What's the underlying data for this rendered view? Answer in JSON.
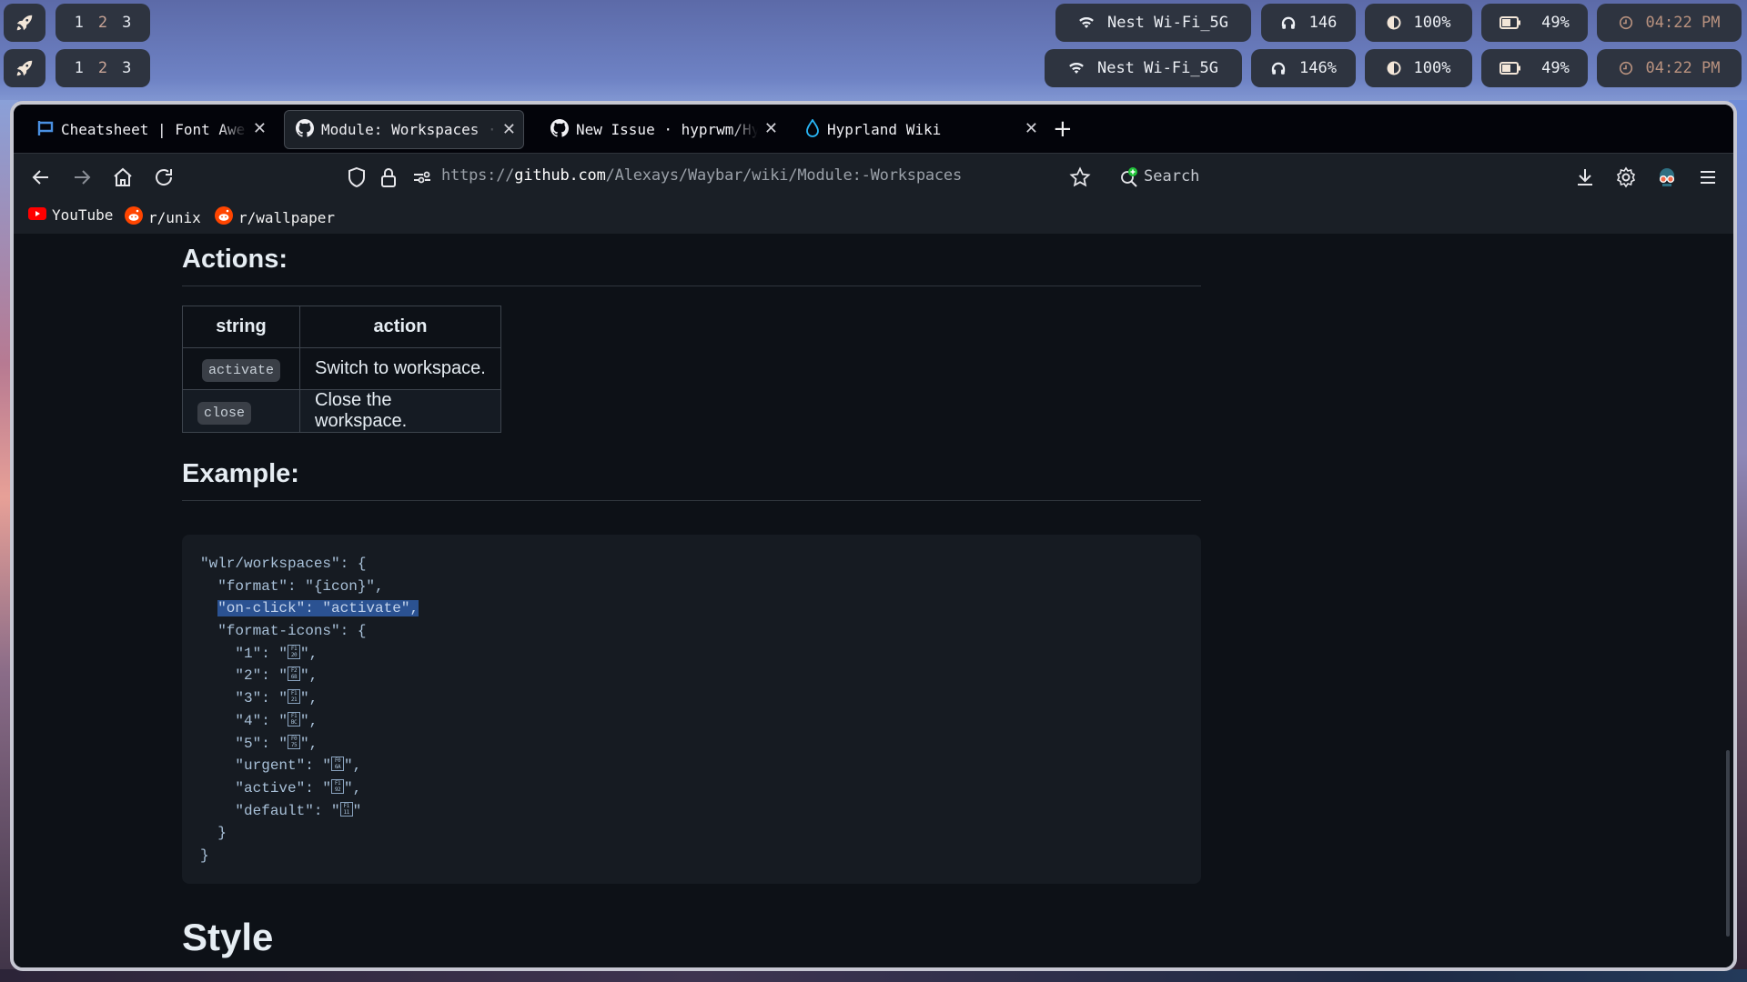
{
  "waybar": {
    "rows": [
      {
        "workspaces": [
          "1",
          "2",
          "3"
        ],
        "active_workspace": "2",
        "wifi": "Nest Wi-Fi_5G",
        "volume": "146",
        "brightness": "100%",
        "battery": "49%",
        "clock": "04:22 PM"
      },
      {
        "workspaces": [
          "1",
          "2",
          "3"
        ],
        "active_workspace": "2",
        "wifi": "Nest Wi-Fi_5G",
        "volume": "146%",
        "brightness": "100%",
        "battery": "49%",
        "clock": "04:22 PM"
      }
    ]
  },
  "browser": {
    "tabs": [
      {
        "title": "Cheatsheet | Font Awesome",
        "icon": "font-awesome-flag-icon",
        "active": false
      },
      {
        "title": "Module: Workspaces · Alexays/Waybar Wiki",
        "icon": "github-icon",
        "active": true
      },
      {
        "title": "New Issue · hyprwm/Hyprland",
        "icon": "github-icon",
        "active": false
      },
      {
        "title": "Hyprland Wiki",
        "icon": "hyprland-drop-icon",
        "active": false
      }
    ],
    "url": {
      "scheme": "https://",
      "host": "github.com",
      "path": "/Alexays/Waybar/wiki/Module:-Workspaces"
    },
    "search_label": "Search",
    "bookmarks": [
      {
        "label": "YouTube",
        "icon": "youtube-icon"
      },
      {
        "label": "r/unix",
        "icon": "reddit-icon"
      },
      {
        "label": "r/wallpaper",
        "icon": "reddit-icon"
      }
    ]
  },
  "page": {
    "actions_heading": "Actions:",
    "actions_table": {
      "headers": [
        "string",
        "action"
      ],
      "rows": [
        [
          "activate",
          "Switch to workspace."
        ],
        [
          "close",
          "Close the workspace."
        ]
      ]
    },
    "example_heading": "Example:",
    "code_lines": [
      "\"wlr/workspaces\": {",
      "  \"format\": \"{icon}\",",
      "  \"on-click\": \"activate\",",
      "  \"format-icons\": {",
      "    \"1\": \"",
      "    \"2\": \"",
      "    \"3\": \"",
      "    \"4\": \"",
      "    \"5\": \"",
      "    \"urgent\": \"",
      "    \"active\": \"",
      "    \"default\": \"",
      "  }",
      "}"
    ],
    "code_glyphs": [
      {
        "line": 4,
        "hex": [
          "F1",
          "20"
        ],
        "suffix": "\","
      },
      {
        "line": 5,
        "hex": [
          "F2",
          "68"
        ],
        "suffix": "\","
      },
      {
        "line": 6,
        "hex": [
          "F1",
          "21"
        ],
        "suffix": "\","
      },
      {
        "line": 7,
        "hex": [
          "F1",
          "BC"
        ],
        "suffix": "\","
      },
      {
        "line": 8,
        "hex": [
          "F0",
          "75"
        ],
        "suffix": "\","
      },
      {
        "line": 9,
        "hex": [
          "F0",
          "6A"
        ],
        "suffix": "\","
      },
      {
        "line": 10,
        "hex": [
          "F1",
          "92"
        ],
        "suffix": "\","
      },
      {
        "line": 11,
        "hex": [
          "F1",
          "11"
        ],
        "suffix": "\""
      }
    ],
    "selected_line": 2,
    "style_heading": "Style"
  },
  "colors": {
    "waybar_pill": "#2e3440",
    "active_workspace": "#c8a496",
    "clock_text": "#b9927f",
    "page_bg": "#0d1117",
    "code_bg": "#161b22",
    "selection": "#2b5292"
  }
}
